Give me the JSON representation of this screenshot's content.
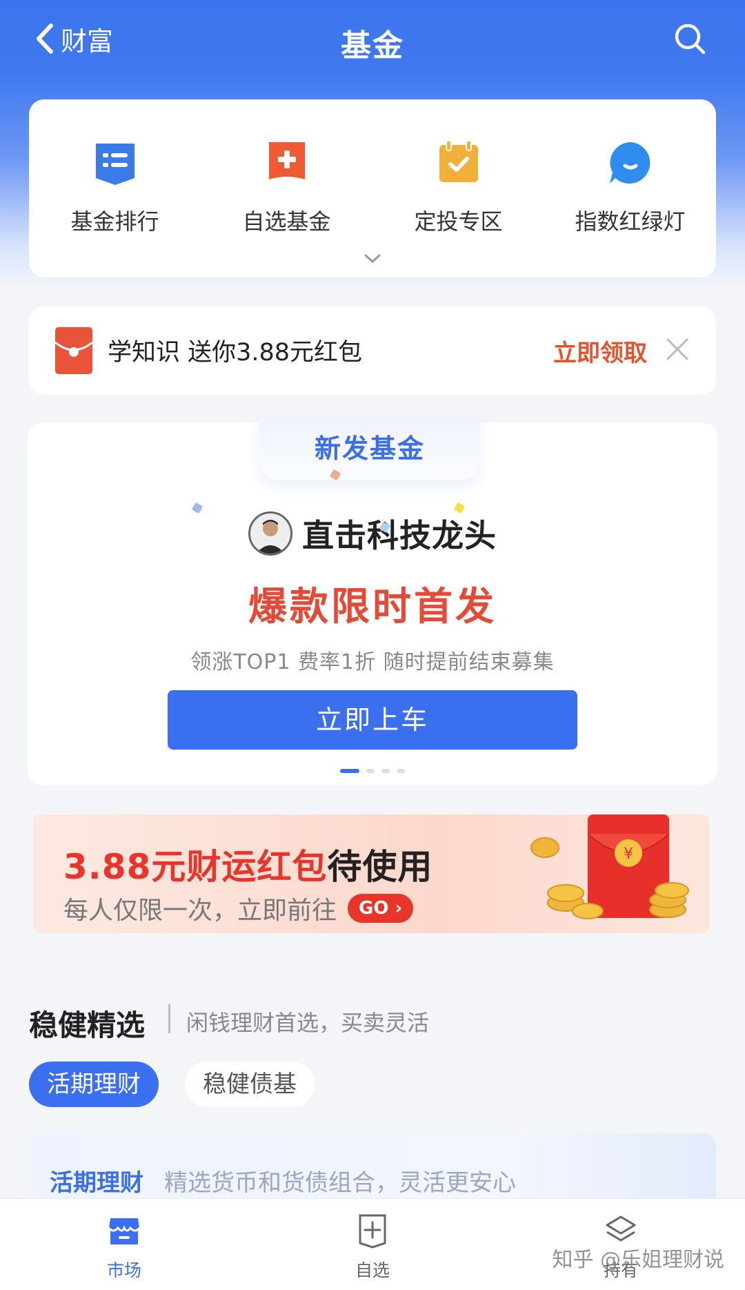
{
  "header": {
    "back_label": "财富",
    "title": "基金"
  },
  "quick_menu": [
    {
      "label": "基金排行",
      "icon": "list-icon",
      "color": "#3a7be8"
    },
    {
      "label": "自选基金",
      "icon": "bookmark-plus-icon",
      "color": "#ee5a32"
    },
    {
      "label": "定投专区",
      "icon": "calendar-check-icon",
      "color": "#f0b03a"
    },
    {
      "label": "指数红绿灯",
      "icon": "chat-bubble-icon",
      "color": "#2f8df0"
    }
  ],
  "promo": {
    "text": "学知识 送你3.88元红包",
    "action": "立即领取"
  },
  "new_fund": {
    "tab": "新发基金",
    "headline": "直击科技龙头",
    "big": "爆款限时首发",
    "sub": "领涨TOP1 费率1折 随时提前结束募集",
    "button": "立即上车"
  },
  "red_packet": {
    "title_red": "3.88元财运红包",
    "title_dark": "待使用",
    "sub": "每人仅限一次，立即前往",
    "go": "GO"
  },
  "section": {
    "title": "稳健精选",
    "subtitle": "闲钱理财首选，买卖灵活",
    "chips": [
      "活期理财",
      "稳健债基"
    ],
    "card_title": "活期理财",
    "card_sub": "精选货币和货债组合，灵活更安心"
  },
  "tabbar": [
    {
      "label": "市场",
      "icon": "store-icon",
      "active": true
    },
    {
      "label": "自选",
      "icon": "add-square-icon",
      "active": false
    },
    {
      "label": "持有",
      "icon": "layers-icon",
      "active": false
    }
  ],
  "watermark": "知乎 @乐姐理财说",
  "colors": {
    "primary": "#3a6ff0",
    "accent_red": "#e9342a"
  }
}
